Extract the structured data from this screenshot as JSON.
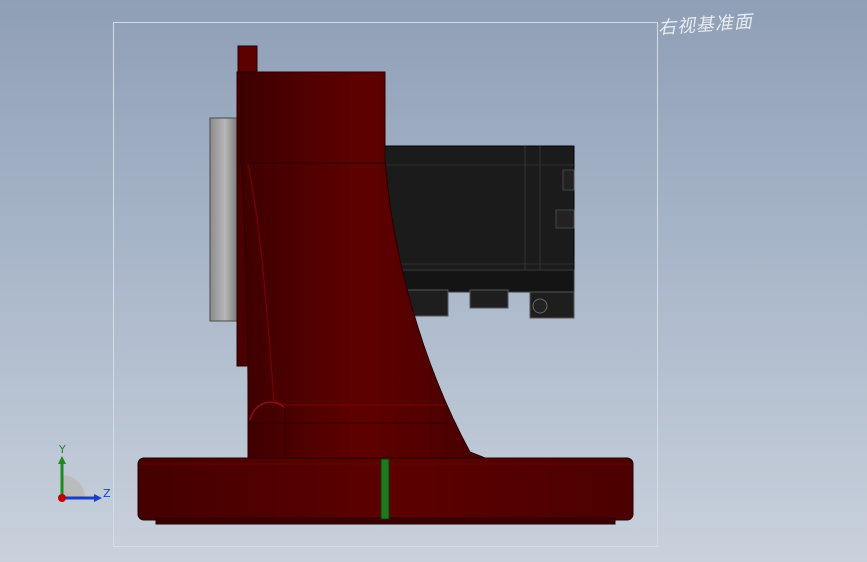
{
  "view": {
    "plane_label": "右视基准面"
  },
  "triad": {
    "y_label": "Y",
    "z_label": "Z"
  },
  "colors": {
    "body": "#5a0000",
    "body_shadow": "#3a0000",
    "motor": "#1a1a1a",
    "marker": "#1f7a1f"
  }
}
